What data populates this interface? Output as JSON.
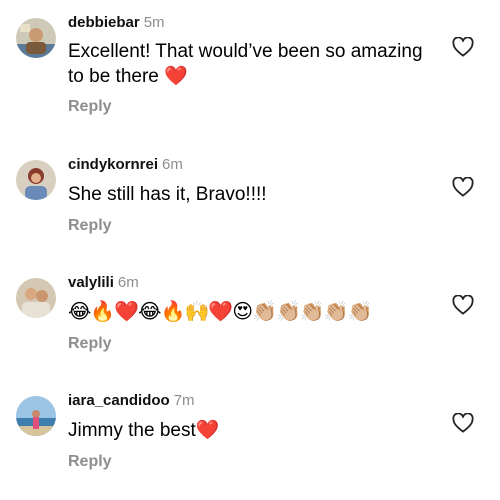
{
  "comments": [
    {
      "username": "debbiebar",
      "time": "5m",
      "text_line1": "Excellent! That would’ve been so amazing",
      "text_line2": "to be there",
      "emoji": "❤️",
      "reply_label": "Reply",
      "avatar_icon": "profile-photo-icon"
    },
    {
      "username": "cindykornrei",
      "time": "6m",
      "text": "She still has it, Bravo!!!!",
      "reply_label": "Reply",
      "avatar_icon": "profile-photo-icon"
    },
    {
      "username": "valylili",
      "time": "6m",
      "emojis": "😂🔥❤️😂🔥🙌❤️😍👏🏼👏🏼👏🏼👏🏼👏🏼",
      "reply_label": "Reply",
      "avatar_icon": "profile-photo-icon"
    },
    {
      "username": "iara_candidoo",
      "time": "7m",
      "text": "Jimmy the best",
      "emoji": "❤️",
      "reply_label": "Reply",
      "avatar_icon": "profile-photo-icon"
    }
  ],
  "colors": {
    "secondary_text": "#8e8e8e",
    "heart_red": "#e0162b",
    "background": "#ffffff"
  },
  "icons": {
    "like": "heart-outline-icon"
  }
}
